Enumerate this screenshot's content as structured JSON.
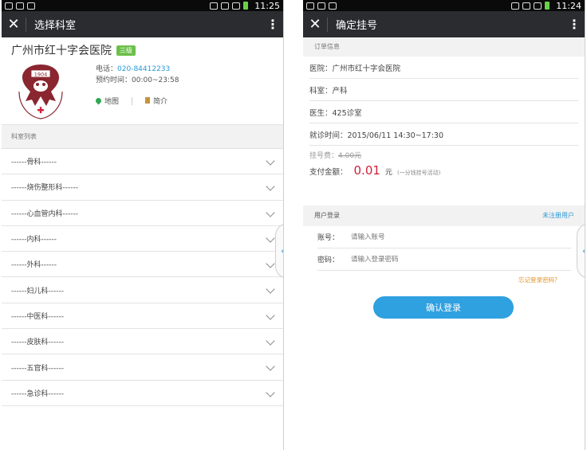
{
  "left": {
    "status": {
      "time": "11:25"
    },
    "title": "选择科室",
    "hospital": {
      "name": "广州市红十字会医院",
      "grade": "三级",
      "phone_label": "电话：",
      "phone": "020-84412233",
      "hours": "预约时间：00:00~23:58",
      "map_label": "地图",
      "intro_label": "简介",
      "logo_year": "1904",
      "logo_name": "广州市红十字会医院"
    },
    "section_label": "科室列表",
    "departments": [
      "------骨科------",
      "------烧伤整形科------",
      "------心血管内科------",
      "------内科------",
      "------外科------",
      "------妇儿科------",
      "------中医科------",
      "------皮肤科------",
      "------五官科------",
      "------急诊科------"
    ]
  },
  "right": {
    "status": {
      "time": "11:24"
    },
    "title": "确定挂号",
    "order_label": "订单信息",
    "hospital": "医院：广州市红十字会医院",
    "department": "科室：产科",
    "doctor": "医生：425诊室",
    "visit_time": "就诊时间：2015/06/11    14:30~17:30",
    "fee_label": "挂号费：",
    "fee_value": "4.00元",
    "pay_label": "支付金额：",
    "pay_amount": "0.01",
    "pay_unit": "元",
    "pay_note": "(一分钱挂号活动)",
    "login_label": "用户登录",
    "register_link": "未注册用户",
    "account_label": "账号：",
    "account_placeholder": "请输入账号",
    "password_label": "密码：",
    "password_placeholder": "请输入登录密码",
    "forgot_link": "忘记登录密码？",
    "login_button": "确认登录"
  },
  "icons": {
    "close": "close-icon",
    "more": "more-vertical-icon",
    "chevron": "chevron-down-icon",
    "side_tab": "chevron-left-icon"
  },
  "colors": {
    "titlebar": "#2a2c2f",
    "accent": "#2a9bd8",
    "price": "#d0213a",
    "forgot": "#e0922a",
    "button": "#2fa0e0",
    "badge": "#6cc04a"
  }
}
